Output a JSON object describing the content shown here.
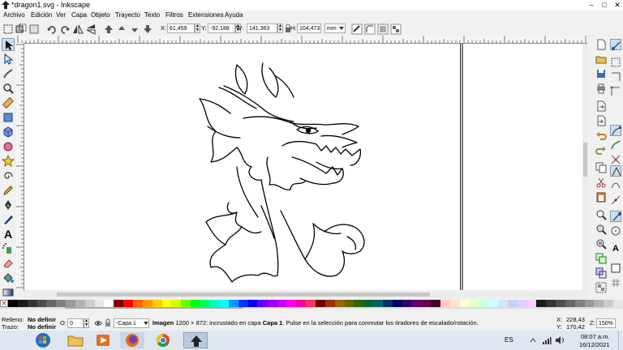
{
  "window": {
    "title": "*dragon1.svg - Inkscape",
    "controls": {
      "minimize": "–",
      "maximize": "□",
      "close": "✕"
    }
  },
  "menu": [
    "Archivo",
    "Edición",
    "Ver",
    "Capa",
    "Objeto",
    "Trayecto",
    "Texto",
    "Filtros",
    "Extensiones",
    "Ayuda"
  ],
  "select_toolbar": {
    "x_label": "X:",
    "x_value": "61,459",
    "y_label": "Y:",
    "y_value": "-92,188",
    "w_label": "W:",
    "w_value": "141,363",
    "h_label": "H:",
    "h_value": "104,473",
    "unit": "mm"
  },
  "status": {
    "fill_label": "Relleno:",
    "fill_value": "No definir",
    "stroke_label": "Trazo:",
    "stroke_value": "No definir",
    "opacity_label": "O:",
    "opacity_value": "0",
    "layer": "-Capa 1",
    "message_type": "Imagen",
    "message_text": " 1200 × 872: incrustado en capa ",
    "message_layer": "Capa 1",
    "message_rest": ". Pulse en la selección para conmutar los tiradores de escalado/rotación.",
    "cursor_x_label": "X:",
    "cursor_x": "228,43",
    "cursor_y_label": "Y:",
    "cursor_y": "170,42",
    "zoom_label": "Z:",
    "zoom": "150%"
  },
  "palette": {
    "colors": [
      "#000000",
      "#1a1a1a",
      "#333333",
      "#4d4d4d",
      "#666666",
      "#808080",
      "#999999",
      "#b3b3b3",
      "#cccccc",
      "#e6e6e6",
      "#ffffff",
      "#800000",
      "#ff0000",
      "#ff6600",
      "#ff9900",
      "#ffcc00",
      "#ffff00",
      "#ccff00",
      "#66ff00",
      "#00ff00",
      "#00ff66",
      "#00ffcc",
      "#00ffff",
      "#0099ff",
      "#0033ff",
      "#0000ff",
      "#6600ff",
      "#9900ff",
      "#cc00ff",
      "#ff00ff",
      "#ff0099",
      "#ff3366",
      "#660000",
      "#993300",
      "#996600",
      "#666600",
      "#336600",
      "#006633",
      "#006666",
      "#003366",
      "#000066",
      "#330066",
      "#660066",
      "#66004d",
      "#4d0026",
      "#ffcccc",
      "#ffe5cc",
      "#ffffcc",
      "#e5ffcc",
      "#ccffe5",
      "#ccffff",
      "#cce5ff",
      "#ccccff",
      "#e5ccff",
      "#ffccff",
      "#1a1a1a",
      "#333333",
      "#4d4d4d",
      "#666666",
      "#808080",
      "#999999",
      "#b3b3b3",
      "#cccccc",
      "#e6e6e6"
    ]
  },
  "taskbar": {
    "language": "ES",
    "time": "08:07 a.m.",
    "date": "16/12/2021"
  }
}
